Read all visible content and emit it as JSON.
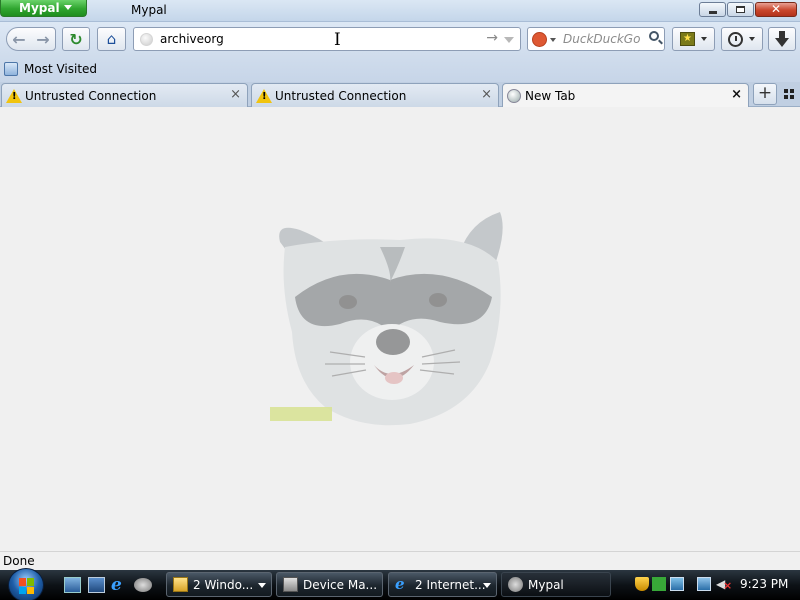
{
  "window": {
    "app_menu_label": "Mypal",
    "title": "Mypal",
    "close_glyph": "✕"
  },
  "toolbar": {
    "back_glyph": "←",
    "forward_glyph": "→",
    "reload_glyph": "↻",
    "home_glyph": "⌂",
    "url_value": "archiveorg",
    "go_glyph": "→",
    "search_engine": "DuckDuckGo",
    "search_placeholder": "DuckDuckGo",
    "star_glyph": "★"
  },
  "bookmarks_bar": {
    "items": [
      {
        "label": "Most Visited"
      }
    ]
  },
  "tabs": [
    {
      "label": "Untrusted Connection",
      "icon": "warning-icon",
      "active": false
    },
    {
      "label": "Untrusted Connection",
      "icon": "warning-icon",
      "active": false
    },
    {
      "label": "New Tab",
      "icon": "globe-icon",
      "active": true
    }
  ],
  "tab_close_glyph": "×",
  "new_tab_glyph": "+",
  "content": {
    "background_image": "raccoon-face-watermark"
  },
  "status": {
    "text": "Done"
  },
  "taskbar": {
    "buttons": [
      {
        "label": "2 Windo...",
        "icon": "folder-icon",
        "grouped": true,
        "active": false
      },
      {
        "label": "Device Ma...",
        "icon": "device-manager-icon",
        "grouped": false,
        "active": false
      },
      {
        "label": "2 Internet...",
        "icon": "ie-icon",
        "grouped": true,
        "active": false
      },
      {
        "label": "Mypal",
        "icon": "mypal-icon",
        "grouped": false,
        "active": true
      }
    ],
    "clock": "9:23 PM"
  },
  "colors": {
    "app_button": "#2fa52f",
    "warning": "#f1c40f",
    "duckduckgo": "#de5833"
  }
}
